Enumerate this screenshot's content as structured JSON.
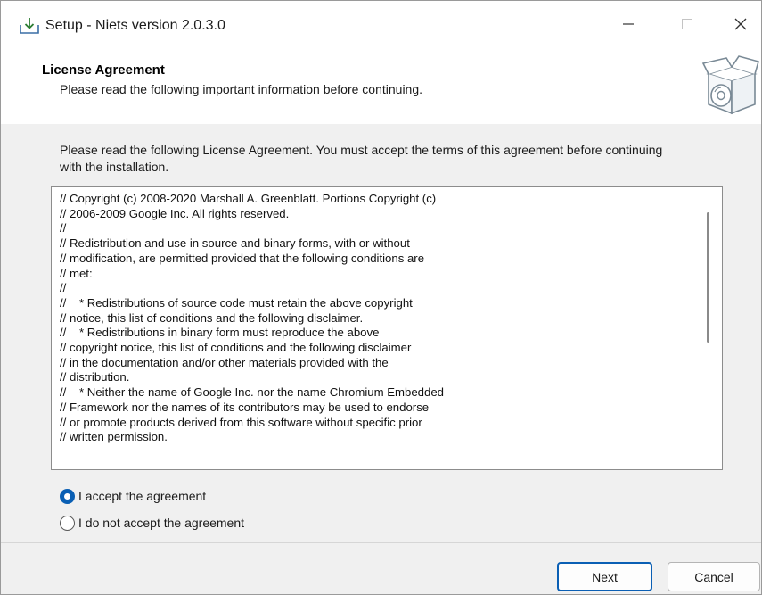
{
  "window": {
    "title": "Setup - Niets version 2.0.3.0",
    "icons": {
      "app": "download-tray-icon",
      "minimize": "minimize-icon",
      "maximize": "maximize-icon",
      "close": "close-icon"
    }
  },
  "header": {
    "title": "License Agreement",
    "subtitle": "Please read the following important information before continuing.",
    "icon": "software-box-disc-icon"
  },
  "intro": "Please read the following License Agreement. You must accept the terms of this agreement before continuing with the installation.",
  "license_lines": [
    "// Copyright (c) 2008-2020 Marshall A. Greenblatt. Portions Copyright (c)",
    "// 2006-2009 Google Inc. All rights reserved.",
    "//",
    "// Redistribution and use in source and binary forms, with or without",
    "// modification, are permitted provided that the following conditions are",
    "// met:",
    "//",
    "//    * Redistributions of source code must retain the above copyright",
    "// notice, this list of conditions and the following disclaimer.",
    "//    * Redistributions in binary form must reproduce the above",
    "// copyright notice, this list of conditions and the following disclaimer",
    "// in the documentation and/or other materials provided with the",
    "// distribution.",
    "//    * Neither the name of Google Inc. nor the name Chromium Embedded",
    "// Framework nor the names of its contributors may be used to endorse",
    "// or promote products derived from this software without specific prior",
    "// written permission."
  ],
  "options": {
    "accept": {
      "label": "I accept the agreement",
      "selected": true
    },
    "decline": {
      "label": "I do not accept the agreement",
      "selected": false
    }
  },
  "buttons": {
    "next": "Next",
    "cancel": "Cancel"
  },
  "colors": {
    "accent": "#0a5fb4"
  }
}
